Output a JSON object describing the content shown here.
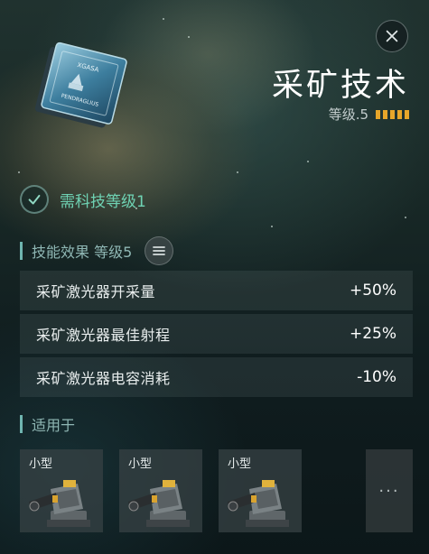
{
  "skill": {
    "title": "采矿技术",
    "level_label": "等级.5",
    "level_pips": 5,
    "book_text": {
      "brand": "XGASA",
      "caption": "PENDRAGLIUS"
    }
  },
  "requirement": {
    "text": "需科技等级1"
  },
  "effects_section": {
    "title": "技能效果 等级5",
    "rows": [
      {
        "name": "采矿激光器开采量",
        "value": "+50%"
      },
      {
        "name": "采矿激光器最佳射程",
        "value": "+25%"
      },
      {
        "name": "采矿激光器电容消耗",
        "value": "-10%"
      }
    ]
  },
  "applies_section": {
    "title": "适用于",
    "cards": [
      {
        "label": "小型",
        "icon": "mining-laser-turret-icon"
      },
      {
        "label": "小型",
        "icon": "mining-laser-turret-icon"
      },
      {
        "label": "小型",
        "icon": "mining-laser-turret-icon"
      }
    ],
    "more_label": "···"
  },
  "colors": {
    "accent_green": "#6fd3b4",
    "pip_orange": "#e7a62a",
    "section_bar": "#6fb5b0"
  },
  "icons": {
    "close": "close-icon",
    "check": "check-icon",
    "menu": "menu-icon",
    "book": "skillbook-icon"
  }
}
